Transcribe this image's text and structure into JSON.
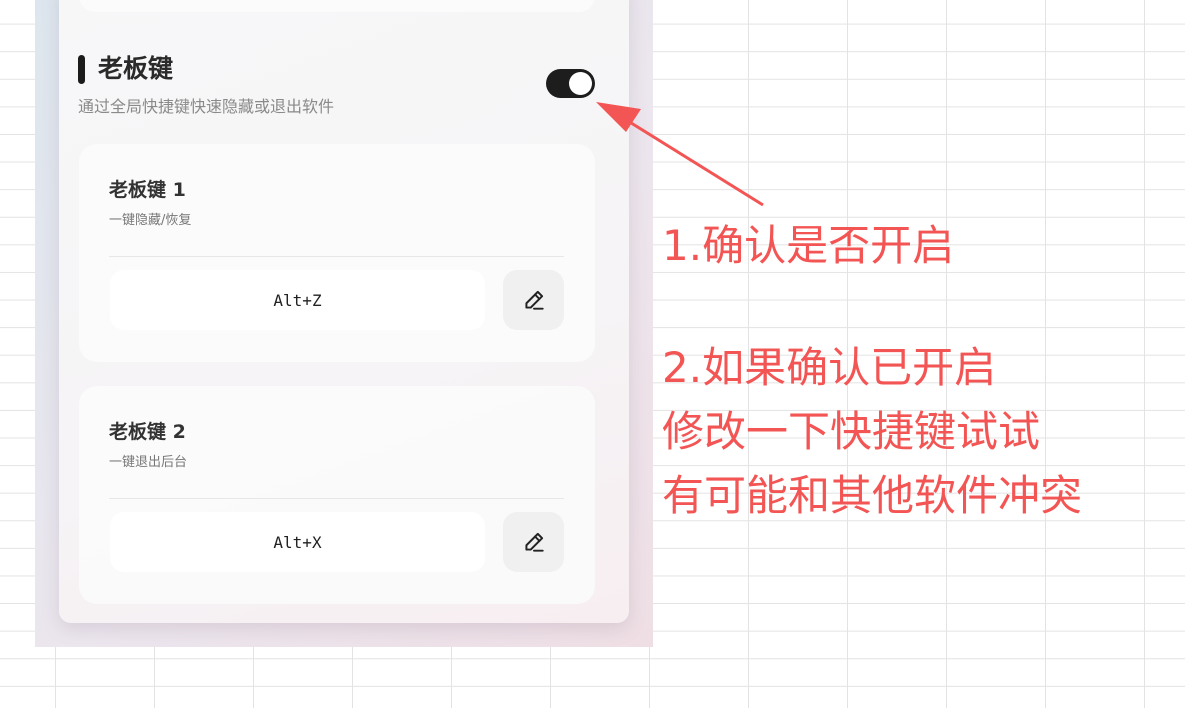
{
  "boss_key_section": {
    "title": "老板键",
    "description": "通过全局快捷键快速隐藏或退出软件",
    "enabled": true
  },
  "boss_keys": [
    {
      "title": "老板键 1",
      "subtitle": "一键隐藏/恢复",
      "shortcut": "Alt+Z",
      "edit_icon": "pencil-icon"
    },
    {
      "title": "老板键 2",
      "subtitle": "一键退出后台",
      "shortcut": "Alt+X",
      "edit_icon": "pencil-icon"
    }
  ],
  "annotation": {
    "step1": "1.确认是否开启",
    "step2_line1": "2.如果确认已开启",
    "step2_line2": "修改一下快捷键试试",
    "step2_line3": "有可能和其他软件冲突",
    "color": "#f25553"
  },
  "colors": {
    "toggle_on": "#1d1d1d",
    "accent_bar": "#1b1b1b"
  }
}
